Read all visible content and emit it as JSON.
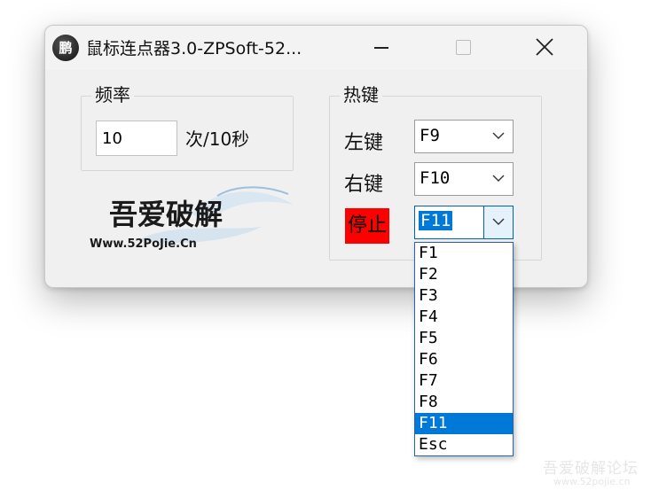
{
  "window": {
    "title": "鼠标连点器3.0-ZPSoft-52...",
    "icon_text": "鹏"
  },
  "frequency": {
    "group_label": "频率",
    "value": "10",
    "unit": "次/10秒"
  },
  "logo": {
    "line1": "吾爱破解",
    "line2": "Www.52PoJie.Cn"
  },
  "hotkeys": {
    "group_label": "热键",
    "left_label": "左键",
    "left_value": "F9",
    "right_label": "右键",
    "right_value": "F10",
    "stop_label": "停止",
    "stop_value": "F11",
    "stop_label_color": "#ff0000",
    "options": [
      "F1",
      "F2",
      "F3",
      "F4",
      "F5",
      "F6",
      "F7",
      "F8",
      "F11",
      "Esc"
    ],
    "selected_option": "F11"
  },
  "watermark": {
    "cn": "吾爱破解论坛",
    "url": "www.52pojie.cn"
  }
}
